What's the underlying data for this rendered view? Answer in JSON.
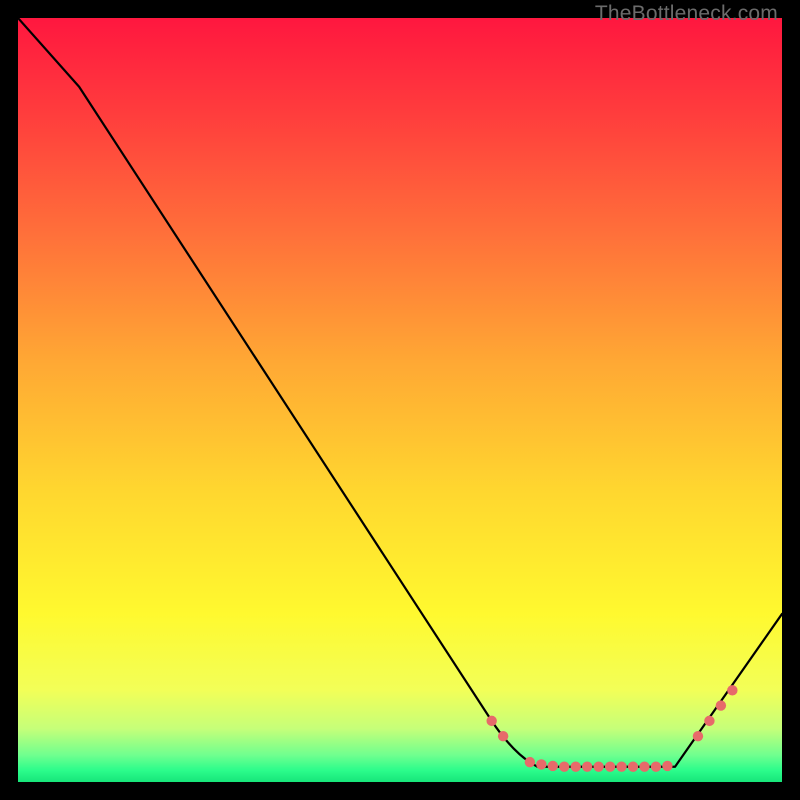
{
  "watermark": "TheBottleneck.com",
  "chart_data": {
    "type": "line",
    "title": "",
    "xlabel": "",
    "ylabel": "",
    "xlim": [
      0,
      100
    ],
    "ylim": [
      0,
      100
    ],
    "grid": false,
    "series": [
      {
        "name": "curve",
        "x": [
          0,
          8,
          62,
          68,
          86,
          100
        ],
        "y": [
          100,
          91,
          8,
          2,
          2,
          22
        ],
        "color": "#000000"
      }
    ],
    "markers": {
      "name": "dots",
      "color": "#e76a6a",
      "points": [
        {
          "x": 62,
          "y": 8
        },
        {
          "x": 63.5,
          "y": 6
        },
        {
          "x": 67,
          "y": 2.6
        },
        {
          "x": 68.5,
          "y": 2.3
        },
        {
          "x": 70,
          "y": 2.1
        },
        {
          "x": 71.5,
          "y": 2.0
        },
        {
          "x": 73,
          "y": 2.0
        },
        {
          "x": 74.5,
          "y": 2.0
        },
        {
          "x": 76,
          "y": 2.0
        },
        {
          "x": 77.5,
          "y": 2.0
        },
        {
          "x": 79,
          "y": 2.0
        },
        {
          "x": 80.5,
          "y": 2.0
        },
        {
          "x": 82,
          "y": 2.0
        },
        {
          "x": 83.5,
          "y": 2.0
        },
        {
          "x": 85,
          "y": 2.1
        },
        {
          "x": 89,
          "y": 6
        },
        {
          "x": 90.5,
          "y": 8
        },
        {
          "x": 92,
          "y": 10
        },
        {
          "x": 93.5,
          "y": 12
        }
      ]
    },
    "background_gradient": {
      "stops": [
        {
          "pos": 0.0,
          "color": "#ff173f"
        },
        {
          "pos": 0.12,
          "color": "#ff3b3d"
        },
        {
          "pos": 0.28,
          "color": "#ff6f3a"
        },
        {
          "pos": 0.45,
          "color": "#ffa834"
        },
        {
          "pos": 0.62,
          "color": "#ffd72f"
        },
        {
          "pos": 0.78,
          "color": "#fff92f"
        },
        {
          "pos": 0.88,
          "color": "#f2ff58"
        },
        {
          "pos": 0.93,
          "color": "#c6ff79"
        },
        {
          "pos": 0.965,
          "color": "#6fff8f"
        },
        {
          "pos": 0.985,
          "color": "#2bfc8b"
        },
        {
          "pos": 1.0,
          "color": "#17e57a"
        }
      ]
    }
  }
}
